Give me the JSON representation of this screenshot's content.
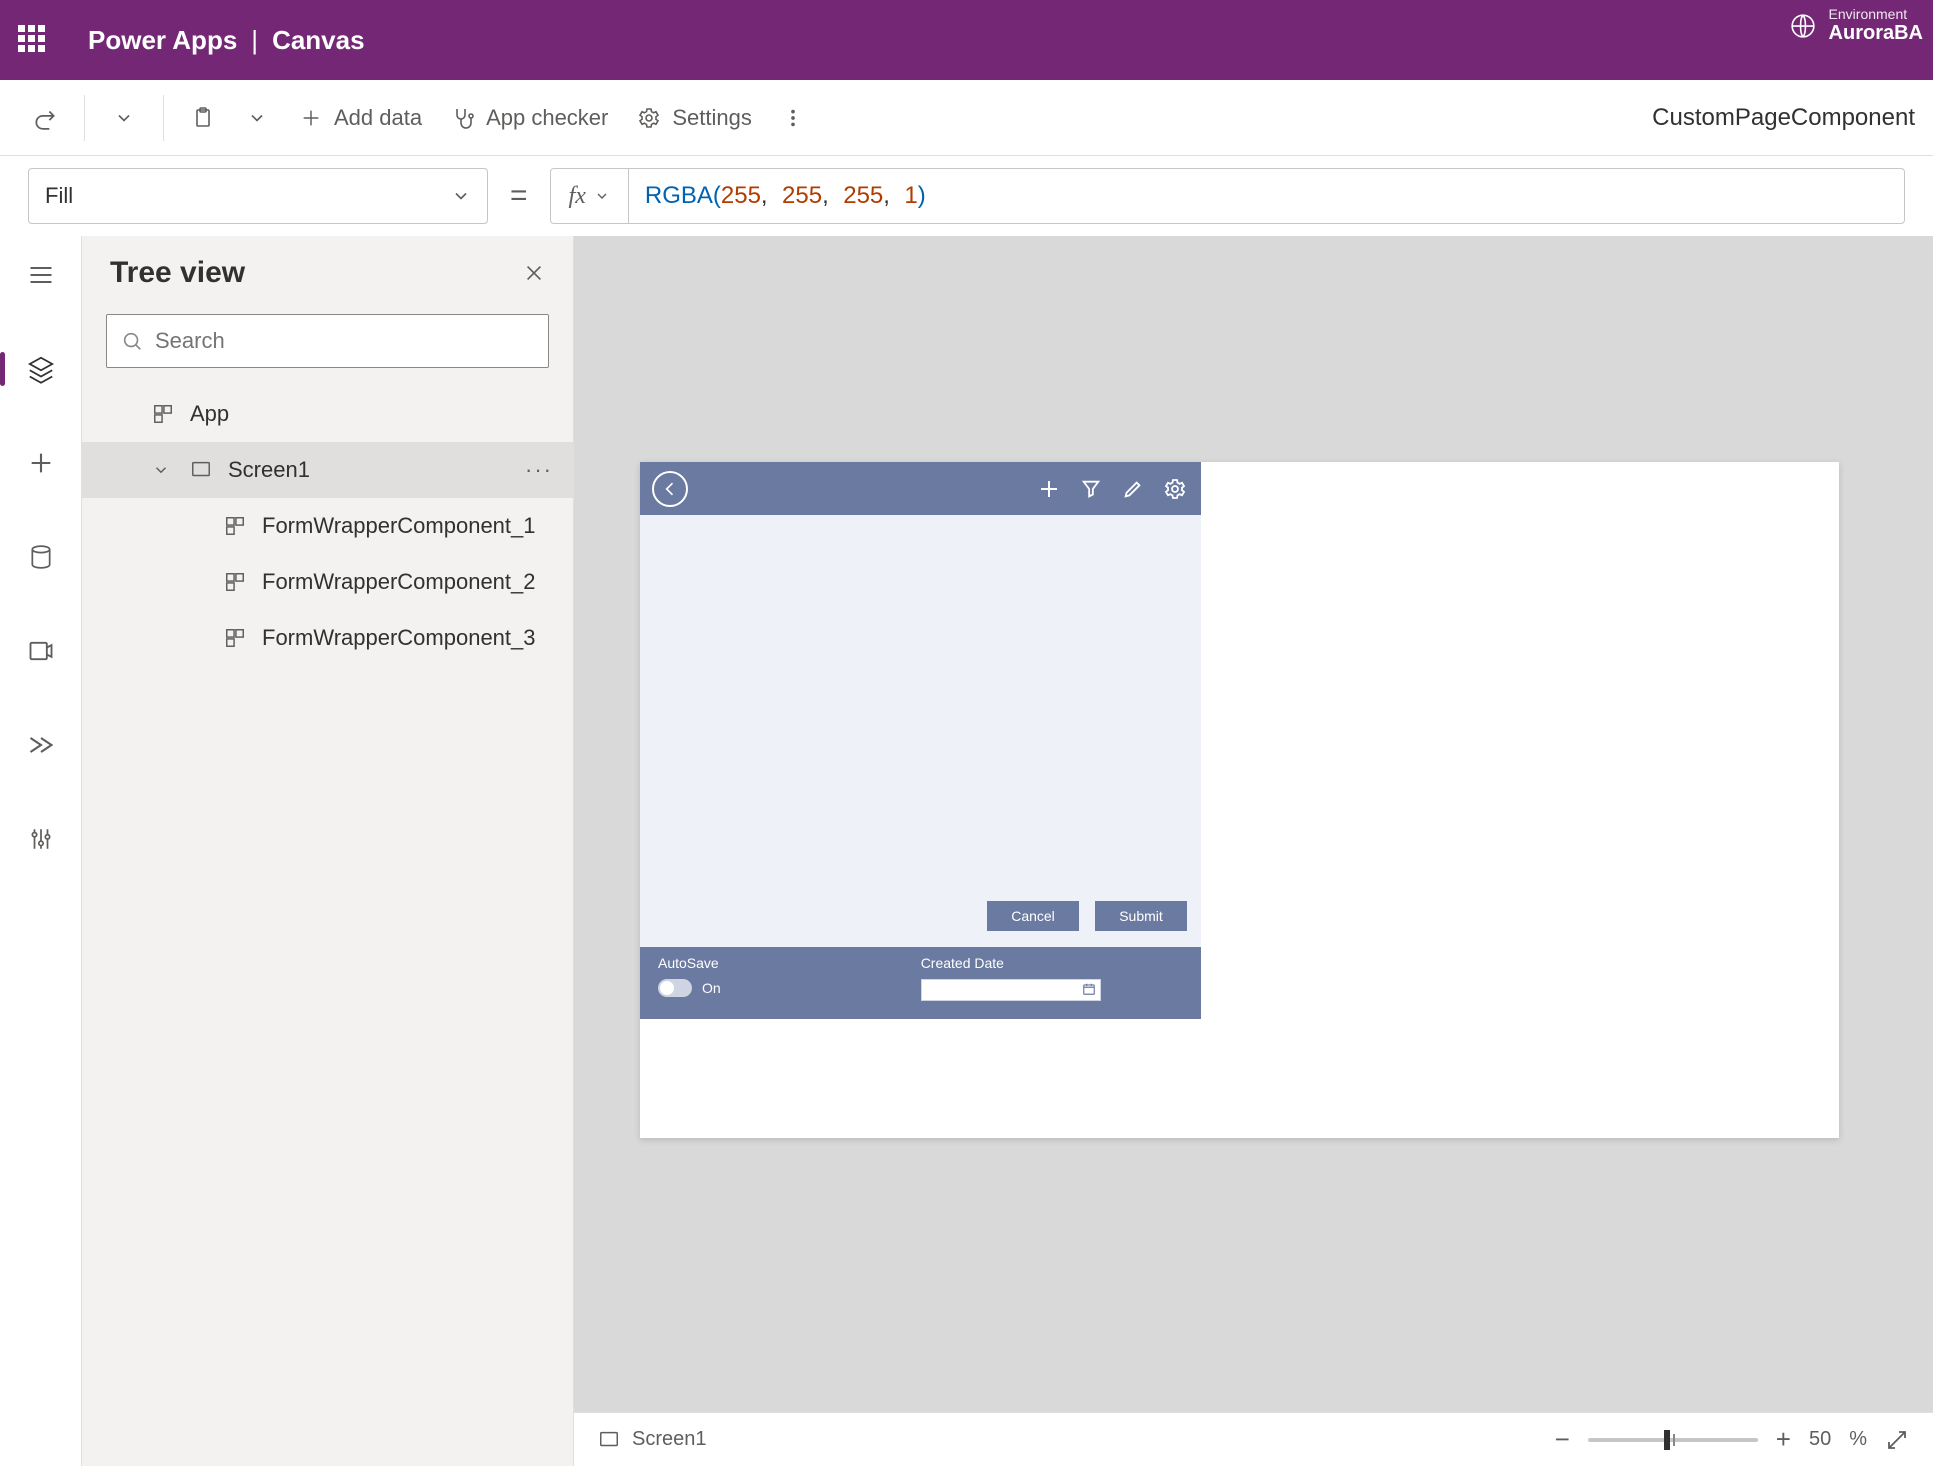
{
  "header": {
    "app_title": "Power Apps",
    "page_type": "Canvas",
    "environment_label": "Environment",
    "environment_name": "AuroraBA"
  },
  "cmdbar": {
    "add_data": "Add data",
    "app_checker": "App checker",
    "settings": "Settings",
    "page_name": "CustomPageComponent"
  },
  "formula": {
    "property": "Fill",
    "fx_label": "fx",
    "tokens": {
      "func": "RGBA",
      "open": "(",
      "n1": "255",
      "n2": "255",
      "n3": "255",
      "n4": "1",
      "close": ")",
      "comma": ","
    }
  },
  "tree": {
    "title": "Tree view",
    "search_placeholder": "Search",
    "app_node": "App",
    "screen_node": "Screen1",
    "children": [
      "FormWrapperComponent_1",
      "FormWrapperComponent_2",
      "FormWrapperComponent_3"
    ]
  },
  "canvas": {
    "buttons": {
      "cancel": "Cancel",
      "submit": "Submit"
    },
    "footer": {
      "autosave_label": "AutoSave",
      "autosave_state": "On",
      "created_label": "Created Date"
    }
  },
  "statusbar": {
    "screen": "Screen1",
    "zoom_value": "50",
    "zoom_unit": "%"
  }
}
